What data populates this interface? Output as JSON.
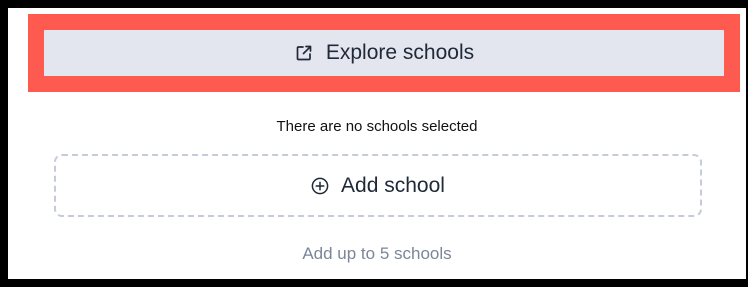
{
  "explore_button": {
    "label": "Explore schools",
    "icon": "external-link-icon"
  },
  "empty_state": {
    "message": "There are no schools selected"
  },
  "add_school_button": {
    "label": "Add school",
    "icon": "plus-circle-icon"
  },
  "hint": {
    "text": "Add up to 5 schools"
  },
  "colors": {
    "highlight_border": "#ff5a50",
    "explore_bg": "#e3e6ef",
    "dashed_border": "#c5ccd8",
    "hint_text": "#7b8699"
  }
}
